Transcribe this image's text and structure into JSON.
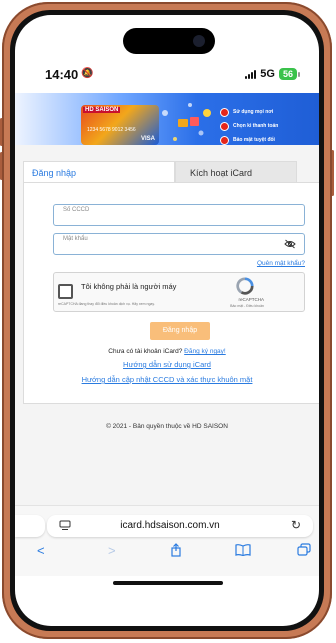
{
  "status_bar": {
    "time": "14:40",
    "network": "5G",
    "battery": "56"
  },
  "banner": {
    "card_logo": "HD SAISON",
    "card_number": "1234 5678 9012 3456",
    "card_brand": "VISA",
    "bullets": [
      "Sử dụng mọi nơi",
      "Chọn kì thanh toán",
      "Bảo mật tuyệt đối"
    ]
  },
  "tabs": {
    "login": "Đăng nhập",
    "activate": "Kích hoạt iCard"
  },
  "form": {
    "cccd_placeholder": "Số CCCD",
    "password_placeholder": "Mật khẩu",
    "forgot_password": "Quên mật khẩu?",
    "login_button": "Đăng nhập"
  },
  "recaptcha": {
    "checkbox_label": "Tôi không phải là người máy",
    "notice": "reCAPTCHA đang thay đổi điều khoản dịch vụ. Hãy xem ngay.",
    "brand": "reCAPTCHA",
    "terms": "Bảo mật - Điều khoản"
  },
  "links": {
    "no_account": "Chưa có tài khoản iCard?",
    "register": "Đăng ký ngay!",
    "guide_use": "Hướng dẫn sử dụng iCard",
    "guide_update": "Hướng dẫn cập nhật CCCD và xác thực khuôn mặt"
  },
  "footer": {
    "copyright": "© 2021 - Bản quyền thuộc về HD SAISON"
  },
  "browser": {
    "url": "icard.hdsaison.com.vn"
  },
  "colors": {
    "accent": "#2a7be0",
    "login_button": "#f9be7a",
    "frame": "#c77a55"
  }
}
